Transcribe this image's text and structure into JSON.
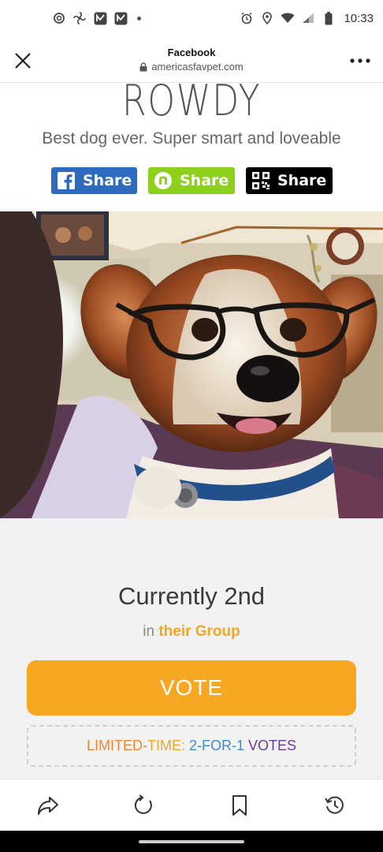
{
  "status_bar": {
    "time": "10:33",
    "left_icons": [
      "threads-icon",
      "fan-icon",
      "n-app-icon",
      "n-app-icon-2",
      "more-dot-icon"
    ],
    "right_icons": [
      "alarm-icon",
      "location-icon",
      "wifi-icon",
      "signal-icon",
      "battery-icon"
    ]
  },
  "header": {
    "title": "Facebook",
    "url": "americasfavpet.com",
    "close_icon": "close-icon",
    "more_icon": "more-horizontal-icon"
  },
  "pet": {
    "name": "ROWDY",
    "description": "Best dog ever. Super smart and loveable"
  },
  "share": {
    "facebook_label": "Share",
    "nextdoor_label": "Share",
    "qr_label": "Share"
  },
  "standing": {
    "rank": "Currently 2nd",
    "group_prefix": "in",
    "group_link": "their Group"
  },
  "vote": {
    "label": "VOTE"
  },
  "promo": {
    "part1": "LIMITED-",
    "part2": "TIME:",
    "part3": " 2-FOR-1 ",
    "part4": "VOTES"
  },
  "bottom_bar": {
    "icons": [
      "share-arrow-icon",
      "refresh-icon",
      "bookmark-icon",
      "history-icon"
    ]
  },
  "colors": {
    "vote_orange": "#f7a823",
    "facebook_blue": "#2c6bbf",
    "nextdoor_green": "#8ed11c",
    "group_link": "#f5a623"
  }
}
